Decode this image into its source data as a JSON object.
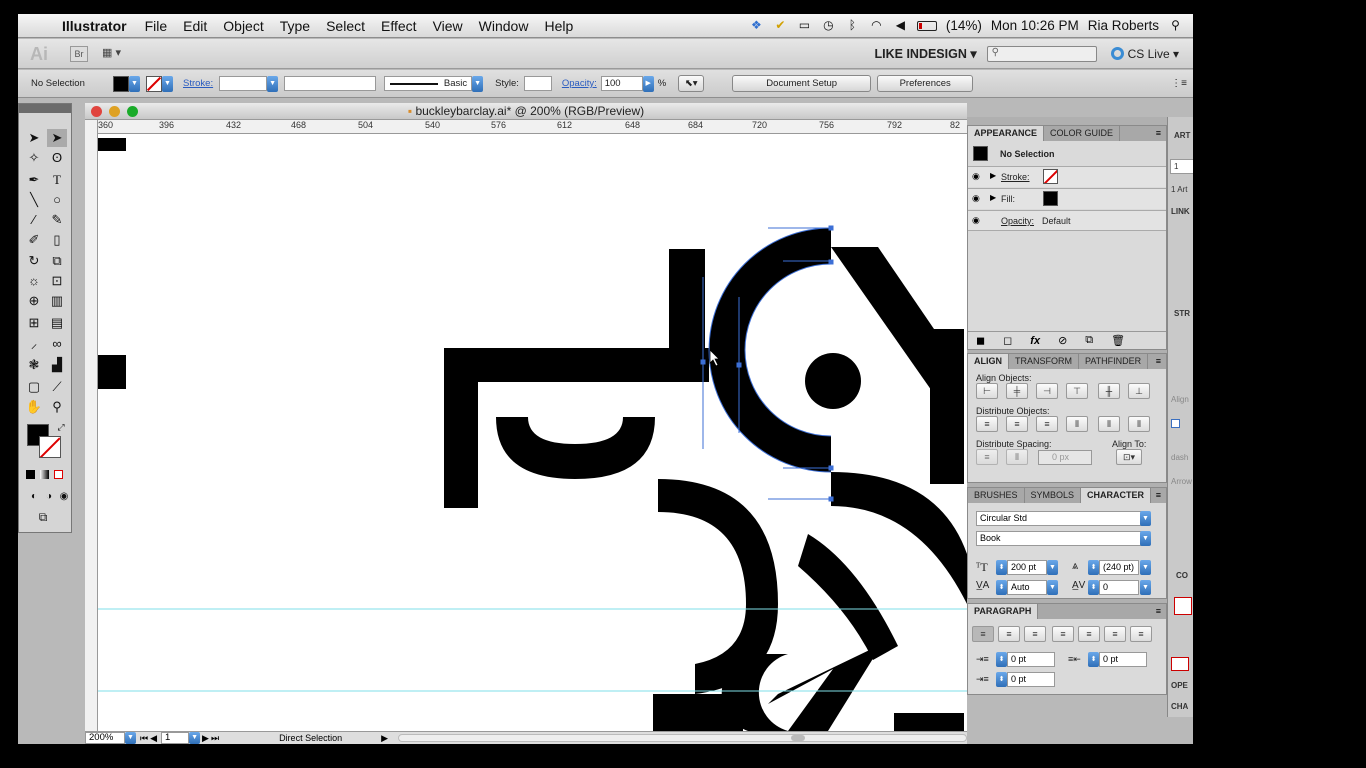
{
  "menubar": {
    "app_name": "Illustrator",
    "items": [
      "File",
      "Edit",
      "Object",
      "Type",
      "Select",
      "Effect",
      "View",
      "Window",
      "Help"
    ],
    "battery": "(14%)",
    "clock": "Mon 10:26 PM",
    "user": "Ria Roberts"
  },
  "appbar": {
    "logo": "Ai",
    "bridge": "Br",
    "workspace": "LIKE INDESIGN ▾",
    "search_placeholder": "",
    "cs_live": "CS Live ▾"
  },
  "control": {
    "selection": "No Selection",
    "stroke_label": "Stroke:",
    "stroke_style": "Basic",
    "style_label": "Style:",
    "opacity_label": "Opacity:",
    "opacity_value": "100",
    "opacity_unit": "%",
    "document_setup": "Document Setup",
    "preferences": "Preferences"
  },
  "document": {
    "title": "buckleybarclay.ai* @ 200% (RGB/Preview)",
    "ruler_ticks": [
      "360",
      "396",
      "432",
      "468",
      "504",
      "540",
      "576",
      "612",
      "648",
      "684",
      "720",
      "756",
      "792",
      "82"
    ],
    "zoom": "200%",
    "page": "1",
    "tool_status": "Direct Selection"
  },
  "appearance": {
    "tabs": [
      "APPEARANCE",
      "COLOR GUIDE"
    ],
    "header": "No Selection",
    "stroke": "Stroke:",
    "fill": "Fill:",
    "opacity": "Opacity:",
    "opacity_value": "Default"
  },
  "align": {
    "tabs": [
      "ALIGN",
      "TRANSFORM",
      "PATHFINDER"
    ],
    "align_objects": "Align Objects:",
    "distribute_objects": "Distribute Objects:",
    "distribute_spacing": "Distribute Spacing:",
    "align_to": "Align To:",
    "spacing_value": "0 px"
  },
  "character": {
    "tabs": [
      "BRUSHES",
      "SYMBOLS",
      "CHARACTER"
    ],
    "font": "Circular Std",
    "style": "Book",
    "size": "200 pt",
    "leading": "(240 pt)",
    "kerning": "Auto",
    "tracking": "0"
  },
  "paragraph": {
    "tab": "PARAGRAPH",
    "indent_left": "0 pt",
    "indent_right": "0 pt",
    "first_line": "0 pt"
  },
  "side_panel": {
    "art_tab": "ART",
    "value": "1",
    "art_label": "1 Art",
    "link_tab": "LINK",
    "str_tab": "STR",
    "align_label": "Align",
    "dash_label": "dash",
    "arrow_label": "Arrow",
    "co_tab": "CO",
    "ope_tab": "OPE",
    "cha_tab": "CHA"
  }
}
